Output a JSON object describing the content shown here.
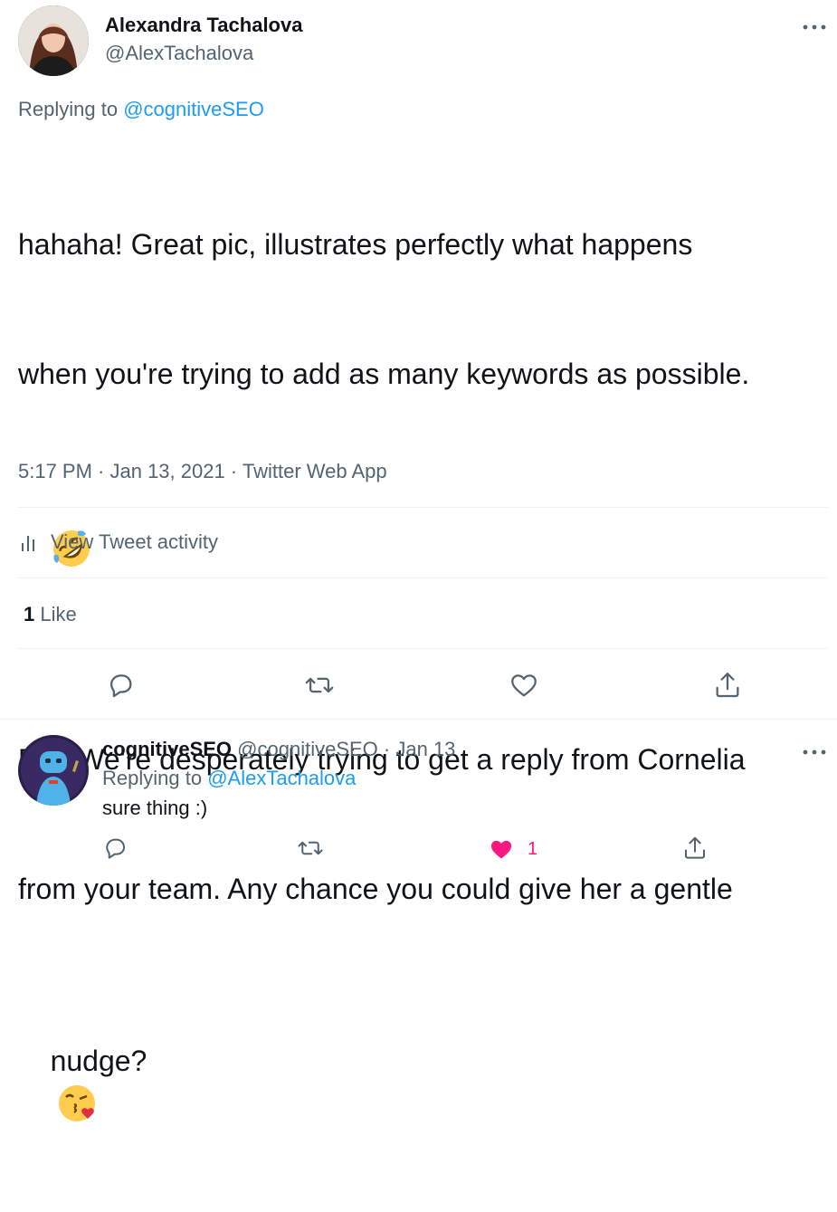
{
  "tweet": {
    "author_name": "Alexandra Tachalova",
    "author_handle": "@AlexTachalova",
    "more_icon": "more-horizontal-icon",
    "replying_prefix": "Replying to",
    "replying_to": "@cognitiveSEO",
    "text_line1": "hahaha! Great pic, illustrates perfectly what happens",
    "text_line2": "when you're trying to add as many keywords as possible.",
    "emoji1": "rolling-on-floor-laughing-emoji",
    "text_line3": "P.S. We're desperately trying to get a reply from Cornelia",
    "text_line4": "from your team. Any chance you could give her a gentle",
    "text_line5": "nudge?",
    "emoji2": "face-blowing-a-kiss-emoji",
    "timestamp": "5:17 PM · Jan 13, 2021 · Twitter Web App",
    "activity_label": "View Tweet activity",
    "like_count": "1",
    "like_label": "Like"
  },
  "reply": {
    "author_name": "cognitiveSEO",
    "author_handle": "@cognitiveSEO",
    "date": "· Jan 13",
    "replying_prefix": "Replying to",
    "replying_to": "@AlexTachalova",
    "text": "sure thing :)",
    "like_count": "1"
  },
  "colors": {
    "link": "#1d9bf0",
    "muted": "#536471",
    "like_pink": "#f91880"
  }
}
